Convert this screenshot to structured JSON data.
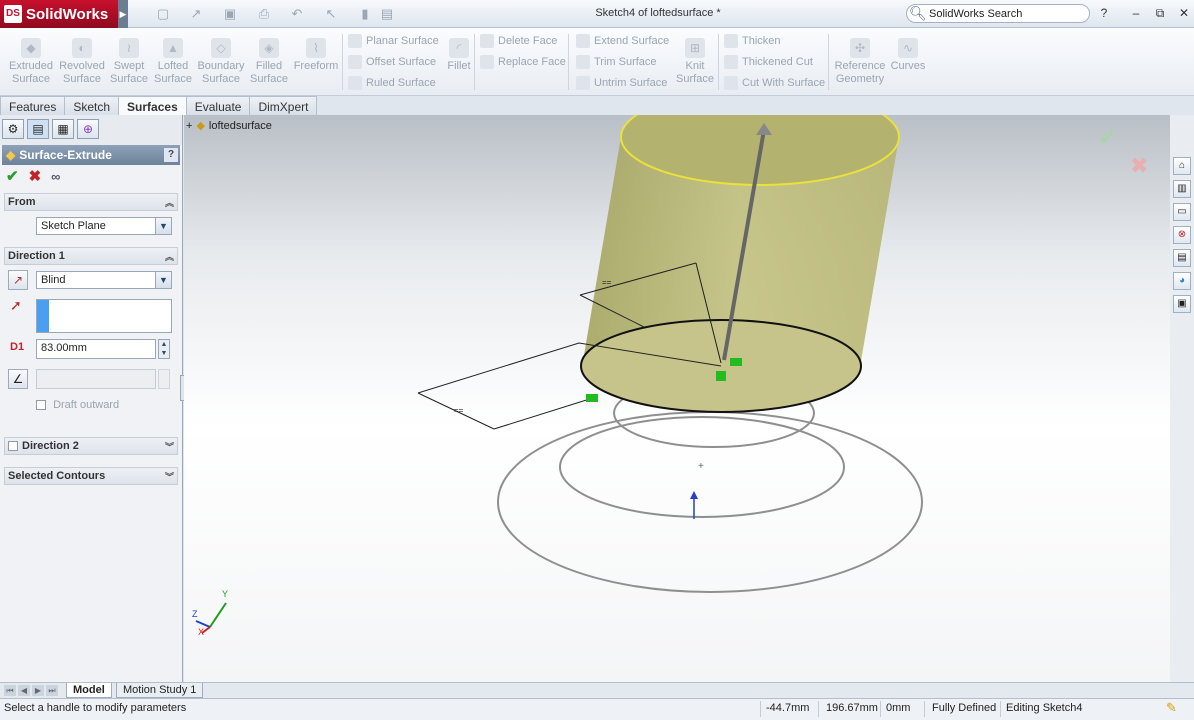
{
  "app": {
    "name": "SolidWorks",
    "logo_mark": "DS"
  },
  "title": "Sketch4 of loftedsurface *",
  "search": {
    "placeholder": "SolidWorks Search"
  },
  "window_controls": {
    "help": "?",
    "minimize": "–",
    "restore": "⧉",
    "close": "✕"
  },
  "ribbon": {
    "tools": [
      {
        "label": "Extruded Surface",
        "icon": "extruded-surface-icon"
      },
      {
        "label": "Revolved Surface",
        "icon": "revolved-surface-icon"
      },
      {
        "label": "Swept Surface",
        "icon": "swept-surface-icon"
      },
      {
        "label": "Lofted Surface",
        "icon": "lofted-surface-icon"
      },
      {
        "label": "Boundary Surface",
        "icon": "boundary-surface-icon"
      },
      {
        "label": "Filled Surface",
        "icon": "filled-surface-icon"
      },
      {
        "label": "Freeform",
        "icon": "freeform-icon"
      }
    ],
    "col1": [
      "Planar Surface",
      "Offset Surface",
      "Ruled Surface"
    ],
    "fillet": "Fillet",
    "col2": [
      "Delete Face",
      "Replace Face"
    ],
    "col3": [
      "Extend Surface",
      "Trim Surface",
      "Untrim Surface"
    ],
    "knit": "Knit Surface",
    "col4": [
      "Thicken",
      "Thickened Cut",
      "Cut With Surface"
    ],
    "reference_geometry": "Reference Geometry",
    "curves": "Curves"
  },
  "tabs": [
    "Features",
    "Sketch",
    "Surfaces",
    "Evaluate",
    "DimXpert"
  ],
  "active_tab": "Surfaces",
  "feature_manager": {
    "title": "Surface-Extrude",
    "help": "?",
    "from": {
      "header": "From",
      "value": "Sketch Plane"
    },
    "direction1": {
      "header": "Direction 1",
      "end_condition": "Blind",
      "depth": "83.00mm",
      "draft_outward": "Draft outward"
    },
    "direction2": {
      "header": "Direction 2"
    },
    "selected_contours": {
      "header": "Selected Contours"
    }
  },
  "tree": {
    "item": "loftedsurface"
  },
  "axes": {
    "x": "X",
    "y": "Y",
    "z": "Z"
  },
  "bottom_tabs": [
    "Model",
    "Motion Study 1"
  ],
  "status": {
    "message": "Select a handle to modify parameters",
    "x": "-44.7mm",
    "y": "196.67mm",
    "z": "0mm",
    "sketch_state": "Fully Defined",
    "mode": "Editing Sketch4"
  },
  "colors": {
    "surface": "#b5b36b",
    "edge_highlight": "#e8e23a",
    "accent": "#c8102e"
  }
}
